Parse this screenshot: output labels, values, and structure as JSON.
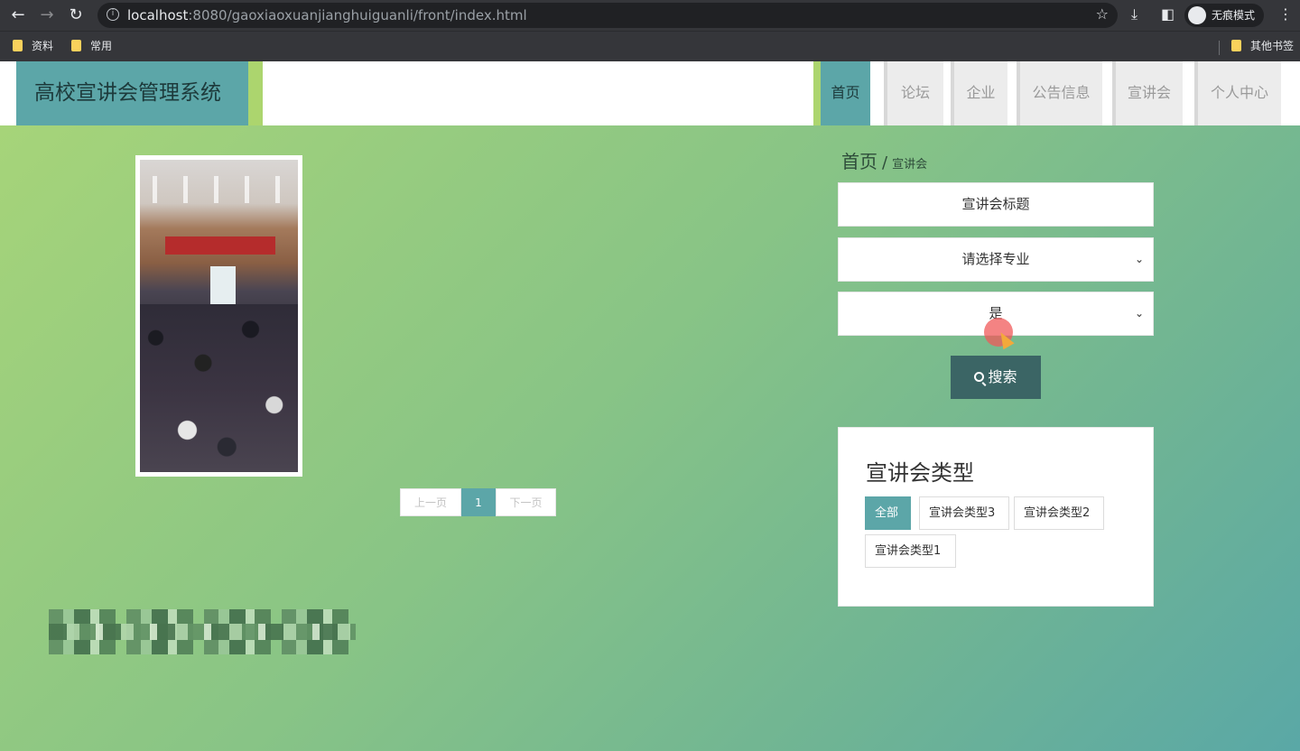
{
  "browser": {
    "url_host": "localhost",
    "url_path": ":8080/gaoxiaoxuanjianghuiguanli/front/index.html",
    "incognito_label": "无痕模式",
    "bookmarks": [
      "资料",
      "常用"
    ],
    "other_bookmarks": "其他书签"
  },
  "header": {
    "site_title": "高校宣讲会管理系统",
    "nav": [
      {
        "label": "首页",
        "active": true
      },
      {
        "label": "论坛"
      },
      {
        "label": "企业"
      },
      {
        "label": "公告信息"
      },
      {
        "label": "宣讲会"
      },
      {
        "label": "个人中心"
      }
    ]
  },
  "breadcrumb": {
    "home": "首页",
    "separator": "/",
    "current": "宣讲会"
  },
  "search": {
    "title_input_placeholder": "宣讲会标题",
    "major_select": "请选择专业",
    "status_select": "是",
    "button_label": "搜索"
  },
  "pagination": {
    "prev": "上一页",
    "current": "1",
    "next": "下一页"
  },
  "types": {
    "title": "宣讲会类型",
    "tags": [
      {
        "label": "全部",
        "active": true
      },
      {
        "label": "宣讲会类型3"
      },
      {
        "label": "宣讲会类型2"
      },
      {
        "label": "宣讲会类型1"
      }
    ]
  },
  "colors": {
    "accent": "#5ca6a8",
    "lime": "#acd56e",
    "button_dark": "#3b6565"
  }
}
